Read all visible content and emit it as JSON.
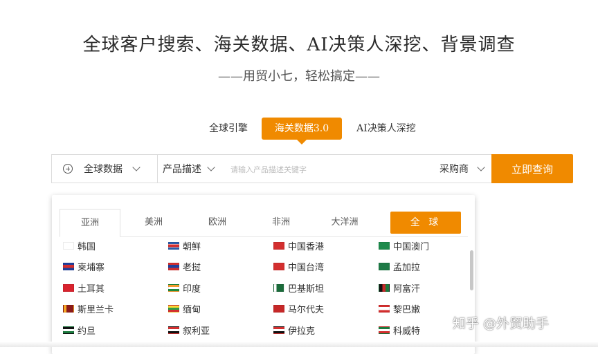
{
  "hero": {
    "title": "全球客户搜索、海关数据、AI决策人深挖、背景调查",
    "subtitle": "——用贸小七，轻松搞定——"
  },
  "tabs": [
    {
      "label": "全球引擎",
      "active": false
    },
    {
      "label": "海关数据3.0",
      "active": true
    },
    {
      "label": "AI决策人深挖",
      "active": false
    }
  ],
  "search": {
    "scope_label": "全球数据",
    "field_label": "产品描述",
    "placeholder": "请输入产品描述关键字",
    "value": "",
    "role_label": "采购商",
    "submit_label": "立即查询"
  },
  "dropdown": {
    "region_tabs": [
      {
        "label": "亚洲",
        "active": true
      },
      {
        "label": "美洲",
        "active": false
      },
      {
        "label": "欧洲",
        "active": false
      },
      {
        "label": "非洲",
        "active": false
      },
      {
        "label": "大洋洲",
        "active": false
      }
    ],
    "all_label": "全 球",
    "countries": [
      {
        "name": "韩国",
        "flag": "flag-kr"
      },
      {
        "name": "朝鲜",
        "flag": "flag-kp"
      },
      {
        "name": "中国香港",
        "flag": "flag-hk"
      },
      {
        "name": "中国澳门",
        "flag": "flag-mo"
      },
      {
        "name": "柬埔寨",
        "flag": "flag-kh"
      },
      {
        "name": "老挝",
        "flag": "flag-la"
      },
      {
        "name": "中国台湾",
        "flag": "flag-tw"
      },
      {
        "name": "孟加拉",
        "flag": "flag-bd"
      },
      {
        "name": "土耳其",
        "flag": "flag-tr"
      },
      {
        "name": "印度",
        "flag": "flag-in"
      },
      {
        "name": "巴基斯坦",
        "flag": "flag-pk"
      },
      {
        "name": "阿富汗",
        "flag": "flag-af"
      },
      {
        "name": "斯里兰卡",
        "flag": "flag-lk"
      },
      {
        "name": "缅甸",
        "flag": "flag-mm"
      },
      {
        "name": "马尔代夫",
        "flag": "flag-mv"
      },
      {
        "name": "黎巴嫩",
        "flag": "flag-lb"
      },
      {
        "name": "约旦",
        "flag": "flag-jo"
      },
      {
        "name": "叙利亚",
        "flag": "flag-sy"
      },
      {
        "name": "伊拉克",
        "flag": "flag-iq"
      },
      {
        "name": "科威特",
        "flag": "flag-kw"
      }
    ]
  },
  "watermark": "知乎 @外贸助手",
  "colors": {
    "accent": "#f08a00",
    "border": "#dcdcdc",
    "text": "#333333"
  }
}
